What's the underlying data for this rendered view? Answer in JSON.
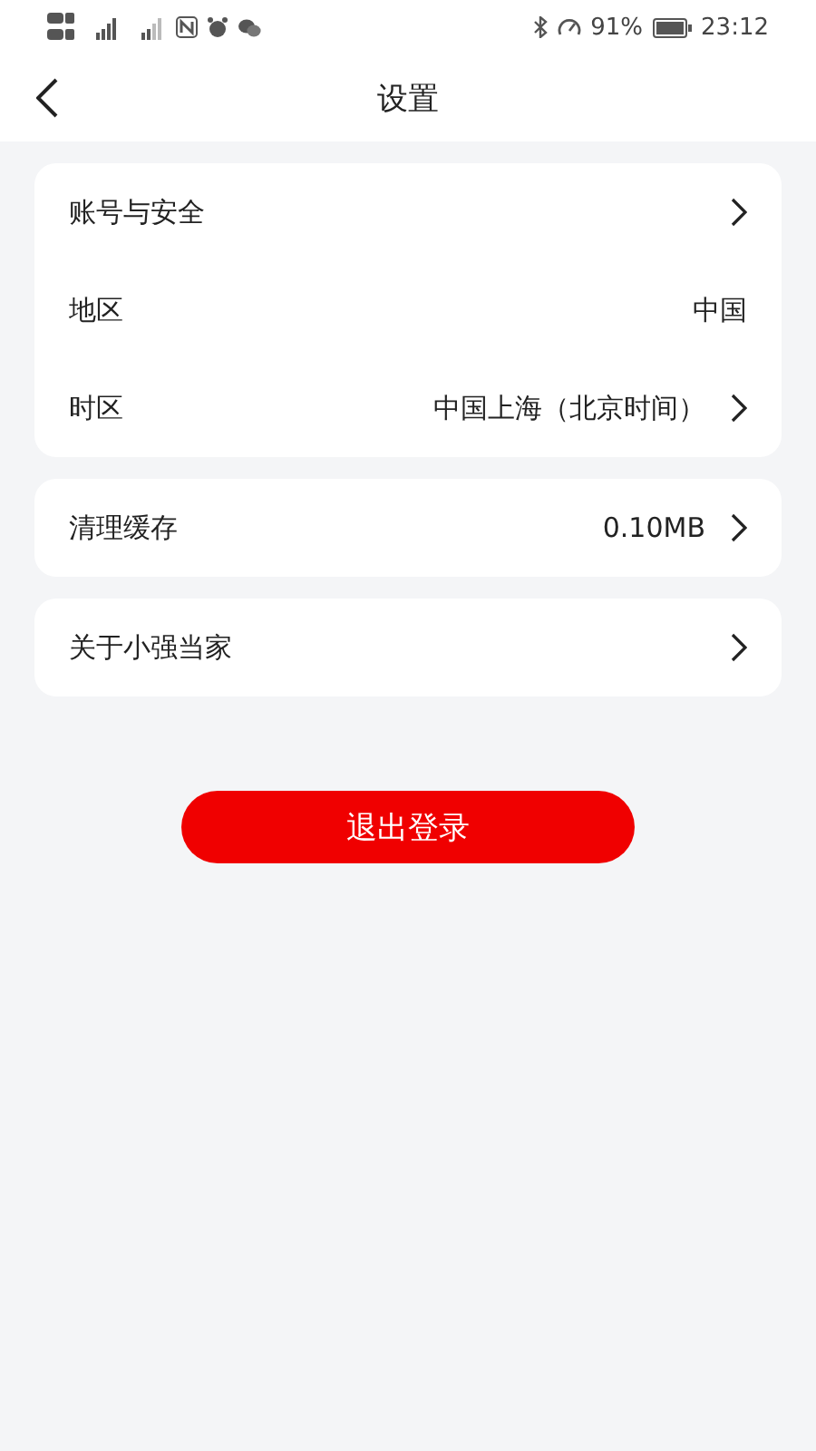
{
  "status_bar": {
    "battery": "91%",
    "time": "23:12"
  },
  "header": {
    "title": "设置"
  },
  "groups": [
    {
      "items": [
        {
          "label": "账号与安全",
          "arrow": true
        },
        {
          "label": "地区",
          "value": "中国",
          "arrow": false
        },
        {
          "label": "时区",
          "value": "中国上海（北京时间）",
          "arrow": true
        }
      ]
    },
    {
      "items": [
        {
          "label": "清理缓存",
          "value": "0.10MB",
          "arrow": true
        }
      ]
    },
    {
      "items": [
        {
          "label": "关于小强当家",
          "arrow": true
        }
      ]
    }
  ],
  "logout_button": "退出登录"
}
